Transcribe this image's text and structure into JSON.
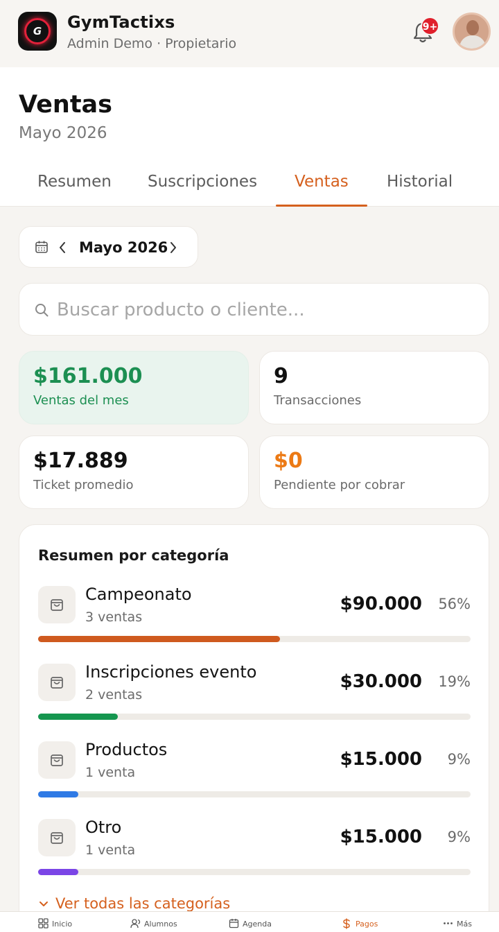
{
  "app": {
    "name": "GymTactixs",
    "subtitle": "Admin Demo · Propietario",
    "logo_mark": "G",
    "notification_badge": "9+"
  },
  "page": {
    "title": "Ventas",
    "subtitle": "Mayo 2026"
  },
  "tabs": [
    {
      "label": "Resumen",
      "active": false
    },
    {
      "label": "Suscripciones",
      "active": false
    },
    {
      "label": "Ventas",
      "active": true
    },
    {
      "label": "Historial",
      "active": false
    }
  ],
  "month_selector": {
    "label": "Mayo 2026",
    "prev_icon": "chevron-left-icon",
    "next_icon": "chevron-right-icon"
  },
  "search": {
    "placeholder": "Buscar producto o cliente...",
    "value": ""
  },
  "stats": [
    {
      "value": "$161.000",
      "label": "Ventas del mes"
    },
    {
      "value": "9",
      "label": "Transacciones"
    },
    {
      "value": "$17.889",
      "label": "Ticket promedio"
    },
    {
      "value": "$0",
      "label": "Pendiente por cobrar"
    }
  ],
  "categories": {
    "title": "Resumen por categoría",
    "items": [
      {
        "name": "Campeonato",
        "count": "3 ventas",
        "amount": "$90.000",
        "percent": "56%",
        "fraction": 0.56,
        "color": "#cf5a1f"
      },
      {
        "name": "Inscripciones evento",
        "count": "2 ventas",
        "amount": "$30.000",
        "percent": "19%",
        "fraction": 0.185,
        "color": "#15964f"
      },
      {
        "name": "Productos",
        "count": "1 venta",
        "amount": "$15.000",
        "percent": "9%",
        "fraction": 0.093,
        "color": "#2f7ae5"
      },
      {
        "name": "Otro",
        "count": "1 venta",
        "amount": "$15.000",
        "percent": "9%",
        "fraction": 0.093,
        "color": "#7b45e6"
      }
    ],
    "see_all": "Ver todas las categorías"
  },
  "colors": {
    "accent": "#d5601e",
    "positive": "#1c8f52",
    "warning": "#ec7a15"
  },
  "bottom_nav": [
    {
      "label": "Inicio",
      "icon": "grid-icon",
      "active": false
    },
    {
      "label": "Alumnos",
      "icon": "users-icon",
      "active": false
    },
    {
      "label": "Agenda",
      "icon": "calendar-icon",
      "active": false
    },
    {
      "label": "Pagos",
      "icon": "dollar-icon",
      "active": true
    },
    {
      "label": "Más",
      "icon": "more-icon",
      "active": false
    }
  ]
}
